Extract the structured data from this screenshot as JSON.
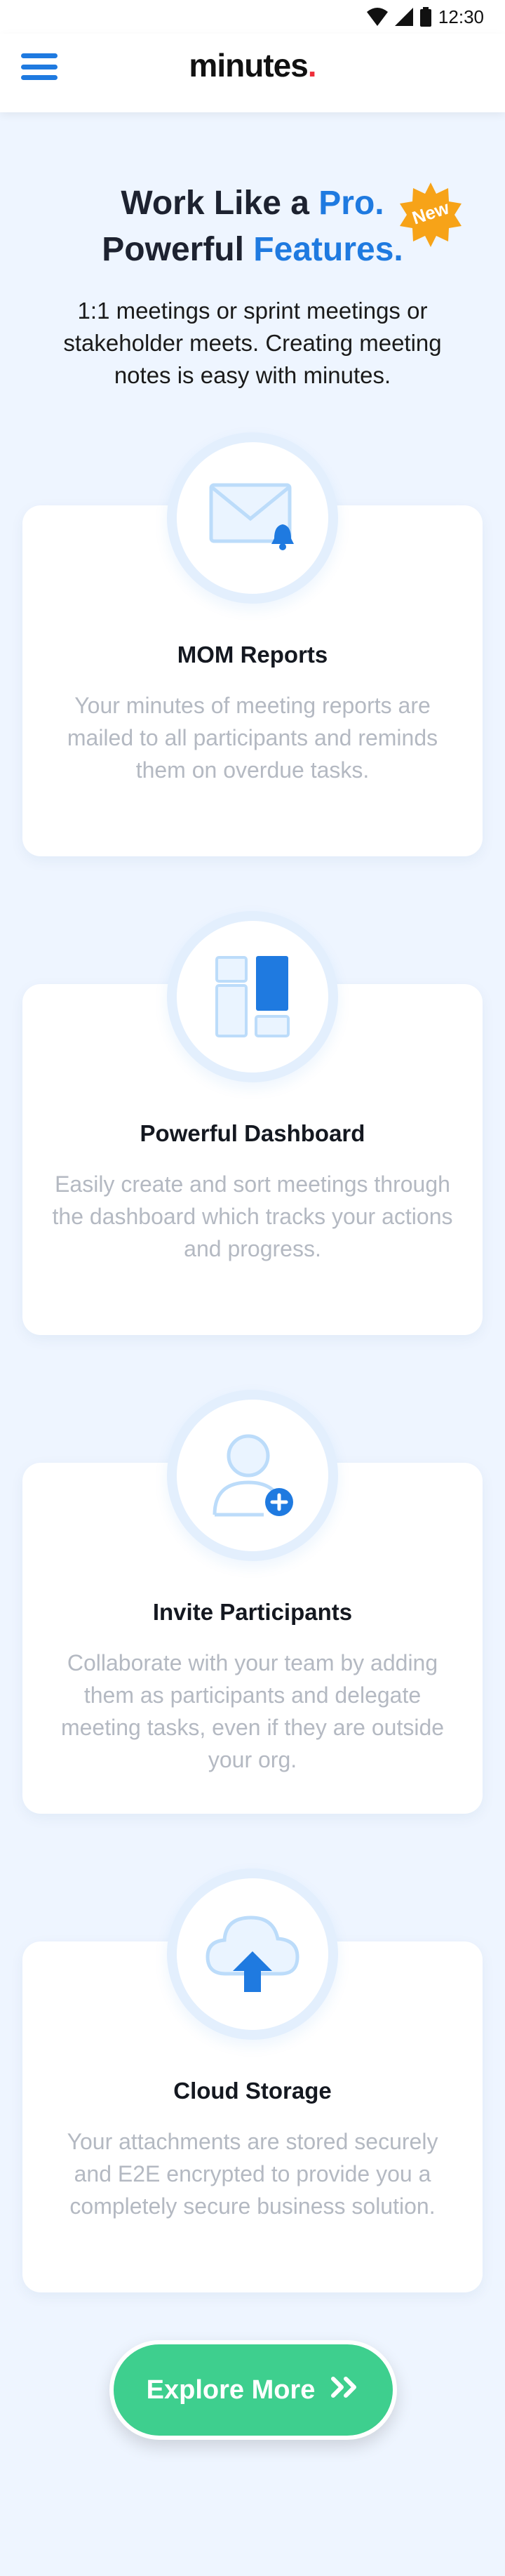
{
  "status": {
    "time": "12:30"
  },
  "header": {
    "logo": "minutes",
    "logo_dot": "."
  },
  "hero": {
    "line1_prefix": "Work Like a ",
    "line1_accent": "Pro.",
    "line2_prefix": "Powerful ",
    "line2_accent": "Features.",
    "badge": "New",
    "subtitle": "1:1 meetings or sprint meetings or stakeholder meets. Creating meeting notes is easy with minutes."
  },
  "features": [
    {
      "title": "MOM Reports",
      "desc": "Your minutes of meeting reports are mailed to all participants and reminds them on overdue tasks.",
      "icon": "mail-bell-icon"
    },
    {
      "title": "Powerful Dashboard",
      "desc": "Easily create and sort meetings through the dashboard which tracks your actions and progress.",
      "icon": "dashboard-icon"
    },
    {
      "title": "Invite Participants",
      "desc": "Collaborate with your team by adding them as participants and delegate meeting tasks, even if they are outside your org.",
      "icon": "add-user-icon"
    },
    {
      "title": "Cloud Storage",
      "desc": "Your attachments are stored securely and E2E encrypted to provide you a completely secure business solution.",
      "icon": "cloud-upload-icon"
    }
  ],
  "cta": {
    "label": "Explore More"
  },
  "colors": {
    "accent": "#1f7ae0",
    "logo_dot": "#ee2f3a",
    "cta": "#3ecf8e",
    "badge": "#f7a318",
    "background": "#eef5ff"
  }
}
